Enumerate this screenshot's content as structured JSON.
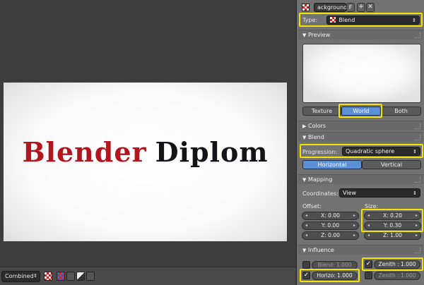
{
  "render": {
    "word1": "Blender",
    "word2": "Diplom"
  },
  "bottombar": {
    "pass_select": "Combined"
  },
  "texture_header": {
    "name": "ackground",
    "fake_user": "F"
  },
  "type": {
    "label": "Type:",
    "value": "Blend"
  },
  "preview": {
    "title": "Preview",
    "tabs": [
      "Texture",
      "World",
      "Both"
    ],
    "active": "World"
  },
  "colors": {
    "title": "Colors"
  },
  "blend": {
    "title": "Blend",
    "progression_label": "Progression:",
    "progression_value": "Quadratic sphere",
    "direction": [
      "Horizontal",
      "Vertical"
    ],
    "active_direction": "Horizontal"
  },
  "mapping": {
    "title": "Mapping",
    "coordinates_label": "Coordinates:",
    "coordinates_value": "View",
    "offset_label": "Offset:",
    "size_label": "Size:",
    "offset": [
      "X: 0.00",
      "Y: 0.00",
      "Z: 0.00"
    ],
    "size": [
      "X: 0.20",
      "Y: 0.30",
      "Z: 1.00"
    ]
  },
  "influence": {
    "title": "Influence",
    "blend": "Blend: 1.000",
    "zenith": "Zenith : 1.000",
    "horizon": "Horizo: 1.000",
    "zenith_lower": "Zenith : 1.000",
    "blend_checked": false,
    "zenith_checked": true,
    "horizon_checked": true,
    "zenith_lower_checked": false
  },
  "colors_accent": {
    "highlight": "#f0e400",
    "active_tab": "#5b8fd6",
    "render_red": "#b3141d"
  }
}
